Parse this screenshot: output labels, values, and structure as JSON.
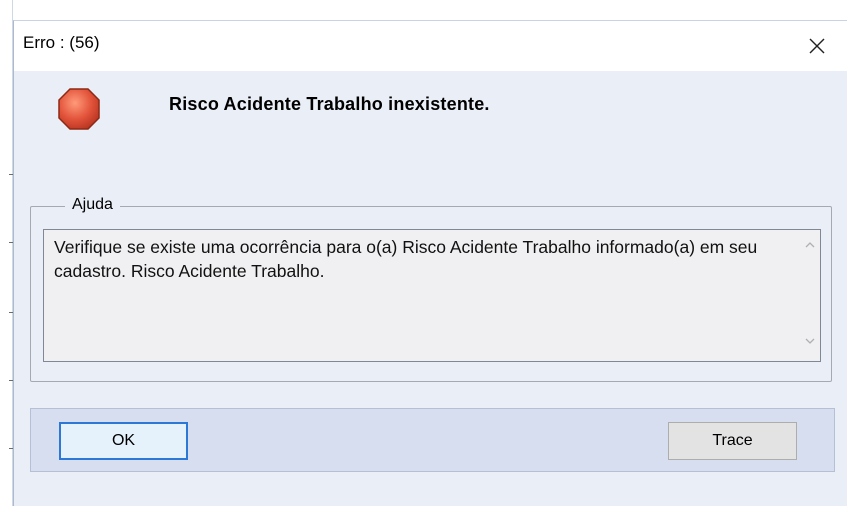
{
  "dialog": {
    "title": "Erro : (56)",
    "icon": "stop-icon",
    "message": "Risco Acidente Trabalho inexistente."
  },
  "help": {
    "group_label": "Ajuda",
    "text": "Verifique se existe uma ocorrência para o(a) Risco Acidente Trabalho informado(a) em seu cadastro. Risco Acidente Trabalho."
  },
  "buttons": {
    "ok_label": "OK",
    "trace_label": "Trace"
  },
  "colors": {
    "dialog_bg": "#eaeef6",
    "button_bar_bg": "#d6def0",
    "focus_border": "#2b78d6",
    "stop_red": "#e2533a"
  }
}
